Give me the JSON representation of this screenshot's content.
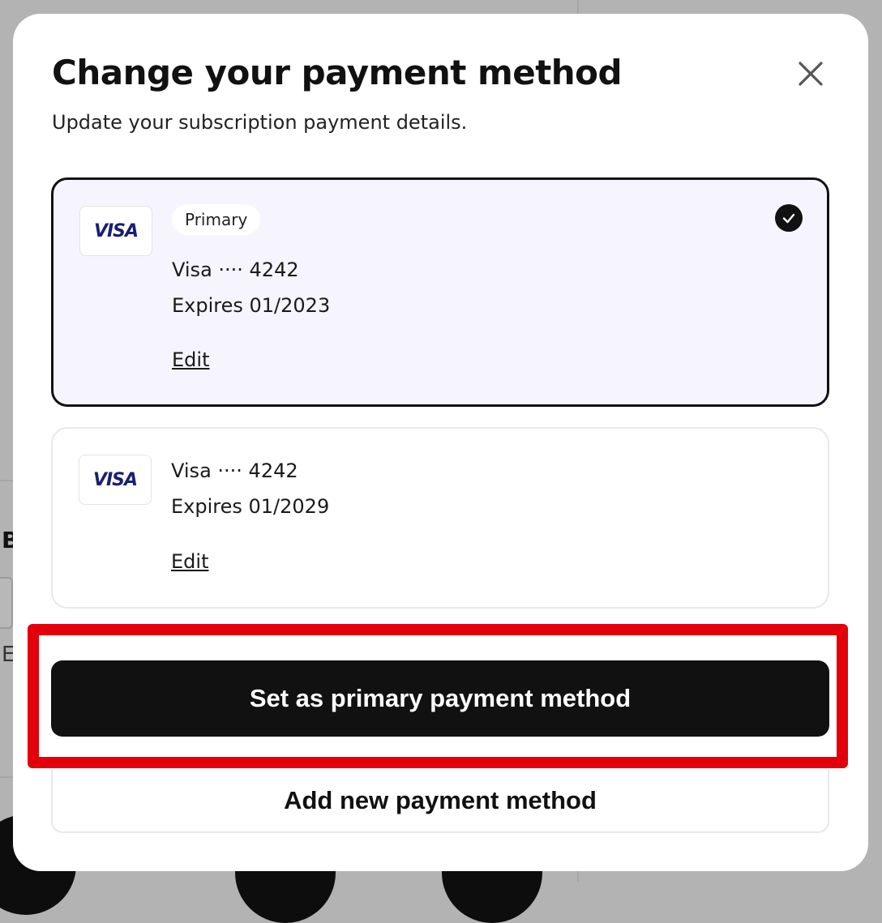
{
  "modal": {
    "title": "Change your payment method",
    "subtitle": "Update your subscription payment details.",
    "close_icon": "close-icon"
  },
  "cards": [
    {
      "brand": "VISA",
      "badge": "Primary",
      "name": "Visa ···· 4242",
      "expires": "Expires 01/2023",
      "edit_label": "Edit",
      "selected": true
    },
    {
      "brand": "VISA",
      "name": "Visa ···· 4242",
      "expires": "Expires 01/2029",
      "edit_label": "Edit",
      "selected": false
    }
  ],
  "actions": {
    "set_primary_label": "Set as primary payment method",
    "add_new_label": "Add new payment method"
  },
  "background": {
    "letter_b": "B",
    "letter_e": "E"
  },
  "colors": {
    "highlight": "#e3000b",
    "visa_blue": "#1a1f71",
    "selected_card_bg": "#f6f4fe",
    "button_bg": "#111111"
  }
}
